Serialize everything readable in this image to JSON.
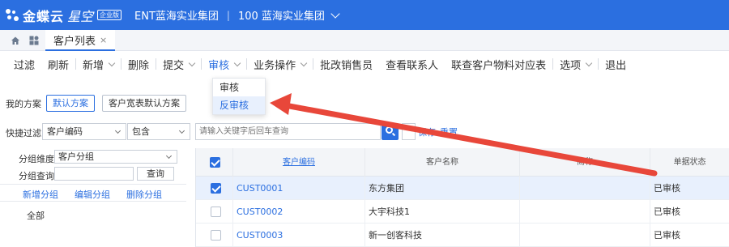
{
  "header": {
    "logo_text": "金蝶云",
    "logo_sub": "星空",
    "logo_badge": "企业版",
    "org1": "ENT蓝海实业集团",
    "separator": "|",
    "org2": "100 蓝海实业集团"
  },
  "tabs": [
    {
      "label": "客户列表",
      "close": "×"
    }
  ],
  "toolbar": {
    "items": [
      "过滤",
      "刷新",
      "新增",
      "删除",
      "提交",
      "审核",
      "业务操作",
      "批改销售员",
      "查看联系人",
      "联查客户物料对应表",
      "选项",
      "退出"
    ]
  },
  "audit_menu": {
    "items": [
      "审核",
      "反审核"
    ]
  },
  "scheme": {
    "label": "我的方案",
    "default_btn": "默认方案",
    "wide_btn": "客户宽表默认方案"
  },
  "quick_filter": {
    "label": "快捷过滤",
    "field": "客户编码",
    "operator": "包含",
    "placeholder": "请输入关键字后回车查询",
    "save": "保存",
    "reset": "重置"
  },
  "left_panel": {
    "dim_label": "分组维度",
    "dim_value": "客户分组",
    "query_label": "分组查询",
    "query_btn": "查询",
    "add_group": "新增分组",
    "edit_group": "编辑分组",
    "delete_group": "删除分组",
    "tree_root": "全部"
  },
  "grid": {
    "headers": [
      "客户编码",
      "客户名称",
      "简称",
      "单据状态"
    ],
    "rows": [
      {
        "code": "CUST0001",
        "name": "东方集团",
        "short": "",
        "status": "已审核",
        "checked": true
      },
      {
        "code": "CUST0002",
        "name": "大宇科技1",
        "short": "",
        "status": "已审核",
        "checked": false
      },
      {
        "code": "CUST0003",
        "name": "新一创客科技",
        "short": "",
        "status": "已审核",
        "checked": false
      }
    ]
  },
  "colors": {
    "brand": "#2b6fe0",
    "arrow": "#e8473a"
  }
}
